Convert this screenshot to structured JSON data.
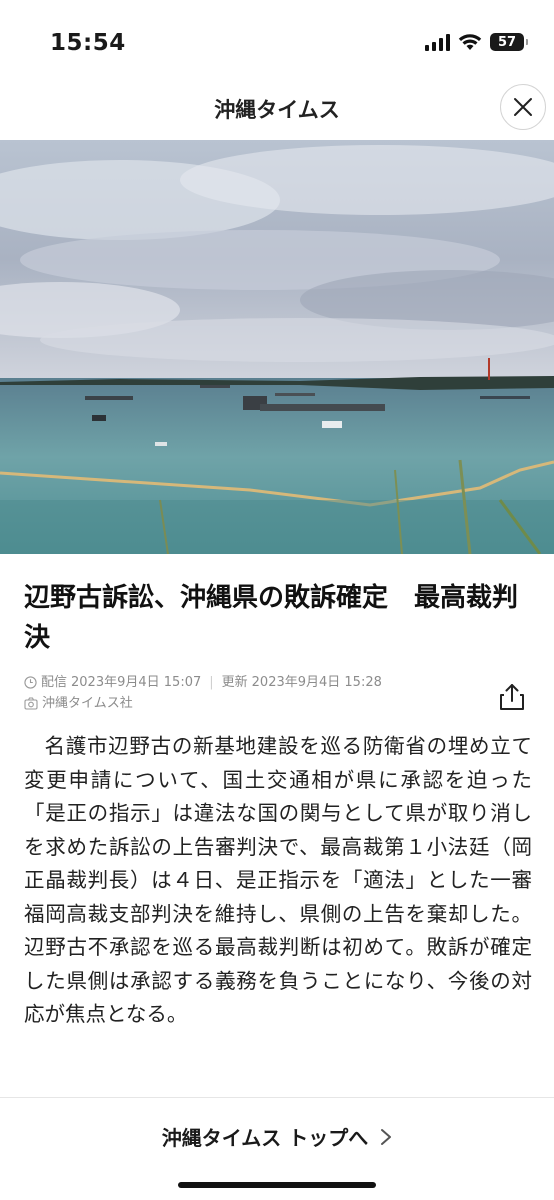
{
  "status_bar": {
    "time": "15:54",
    "battery": "57",
    "icons": [
      "signal-icon",
      "wifi-icon",
      "battery-icon"
    ]
  },
  "header": {
    "title": "沖縄タイムス",
    "close_icon": "close-icon"
  },
  "hero_image": {
    "description_icon": "photo"
  },
  "article": {
    "headline": "辺野古訴訟、沖縄県の敗訴確定　最高裁判決",
    "delivered_label": "配信",
    "delivered_at": "2023年9月4日 15:07",
    "updated_label": "更新",
    "updated_at": "2023年9月4日 15:28",
    "source": "沖縄タイムス社",
    "body": "名護市辺野古の新基地建設を巡る防衛省の埋め立て変更申請について、国土交通相が県に承認を迫った「是正の指示」は違法な国の関与として県が取り消しを求めた訴訟の上告審判決で、最高裁第１小法廷（岡正晶裁判長）は４日、是正指示を「適法」とした一審福岡高裁支部判決を維持し、県側の上告を棄却した。辺野古不承認を巡る最高裁判断は初めて。敗訴が確定した県側は承認する義務を負うことになり、今後の対応が焦点となる。"
  },
  "footer": {
    "link_label": "沖縄タイムス トップへ",
    "chevron_icon": "chevron-right-icon"
  }
}
